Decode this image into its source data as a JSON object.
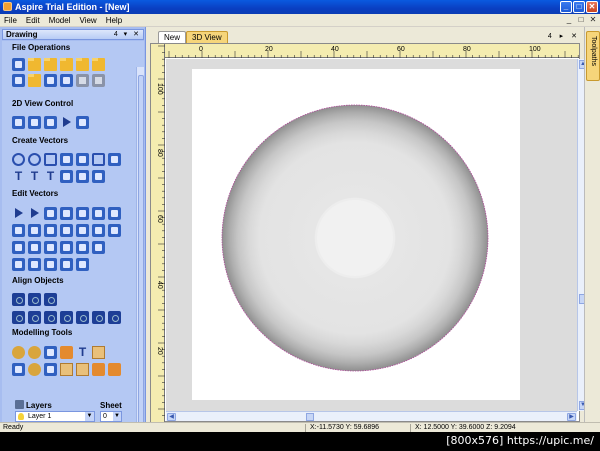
{
  "window": {
    "title": "Aspire Trial Edition - [New]",
    "controls": {
      "minimize": "_",
      "maximize": "□",
      "close": "✕"
    }
  },
  "menu": [
    "File",
    "Edit",
    "Model",
    "View",
    "Help"
  ],
  "mdi_controls": [
    "_",
    "□",
    "✕"
  ],
  "drawing_panel": {
    "title": "Drawing",
    "buttons": "4 ▾ ✕",
    "sections": [
      {
        "title": "File Operations",
        "rows": [
          [
            "new-file-icon",
            "open-folder-icon",
            "open-folder-icon",
            "save-folder-icon",
            "save-as-icon",
            "import-icon"
          ],
          [
            "job-setup-icon",
            "import-vectors-icon",
            "copy-icon",
            "paste-icon",
            "undo-icon",
            "redo-icon"
          ]
        ]
      },
      {
        "title": "2D View Control",
        "rows": [
          [
            "pan-icon",
            "zoom-box-icon",
            "zoom-fit-icon",
            "zoom-selected-icon",
            "zoom-page-icon"
          ]
        ]
      },
      {
        "title": "Create Vectors",
        "rows": [
          [
            "circle-icon",
            "ellipse-icon",
            "rectangle-icon",
            "polyline-icon",
            "curve-icon",
            "polygon-icon",
            "star-icon"
          ],
          [
            "text-icon",
            "text-on-curve-icon",
            "fit-text-icon",
            "dimension-icon",
            "array-icon",
            "bitmap-trace-icon"
          ]
        ]
      },
      {
        "title": "Edit Vectors",
        "rows": [
          [
            "select-icon",
            "node-edit-icon",
            "transform-icon",
            "group-icon",
            "ungroup-icon",
            "mirror-icon",
            "scissors-icon"
          ],
          [
            "move-icon",
            "scale-icon",
            "rotate-icon",
            "distort-icon",
            "weld-icon",
            "subtract-icon",
            "intersect-icon"
          ],
          [
            "fillet-icon",
            "offset-icon",
            "trim-icon",
            "extend-icon",
            "join-icon",
            "smooth-icon"
          ],
          [
            "close-vector-icon",
            "join-open-icon",
            "split-icon",
            "curve-fit-icon",
            "merge-icon"
          ]
        ]
      },
      {
        "title": "Align Objects",
        "rows": [
          [
            "align-center-icon",
            "align-horizontal-icon",
            "align-vertical-icon"
          ],
          [
            "align-left-icon",
            "align-right-icon",
            "align-top-icon",
            "align-bottom-icon",
            "distribute-h-icon",
            "distribute-v-icon",
            "space-icon"
          ]
        ]
      },
      {
        "title": "Modelling Tools",
        "rows": [
          [
            "create-shape-icon",
            "dome-icon",
            "two-rail-icon",
            "extrude-icon",
            "texture-icon",
            "fade-icon"
          ],
          [
            "smoothing-icon",
            "sculpt-icon",
            "tilt-icon",
            "tidy-icon",
            "component-icon",
            "relief-icon",
            "mold-icon"
          ]
        ]
      }
    ]
  },
  "layers": {
    "label": "Layers",
    "sheet_label": "Sheet",
    "current_layer": "Layer 1",
    "sheet_value": "0"
  },
  "tabs": [
    {
      "label": "New",
      "active": true
    },
    {
      "label": "3D View",
      "active": false
    }
  ],
  "tab_controls": "4 ▸ ✕",
  "right_tab": "Toolpaths",
  "ruler": {
    "h_labels": [
      "0",
      "20",
      "40",
      "60",
      "80",
      "100"
    ],
    "v_labels": [
      "100",
      "80",
      "60",
      "40",
      "20"
    ]
  },
  "status": {
    "left": "Ready",
    "cursor": "X:-11.5730 Y: 59.6896",
    "position": "X: 12.5000 Y: 39.6000 Z:  9.2094"
  },
  "caption": "[800x576] https://upic.me/"
}
